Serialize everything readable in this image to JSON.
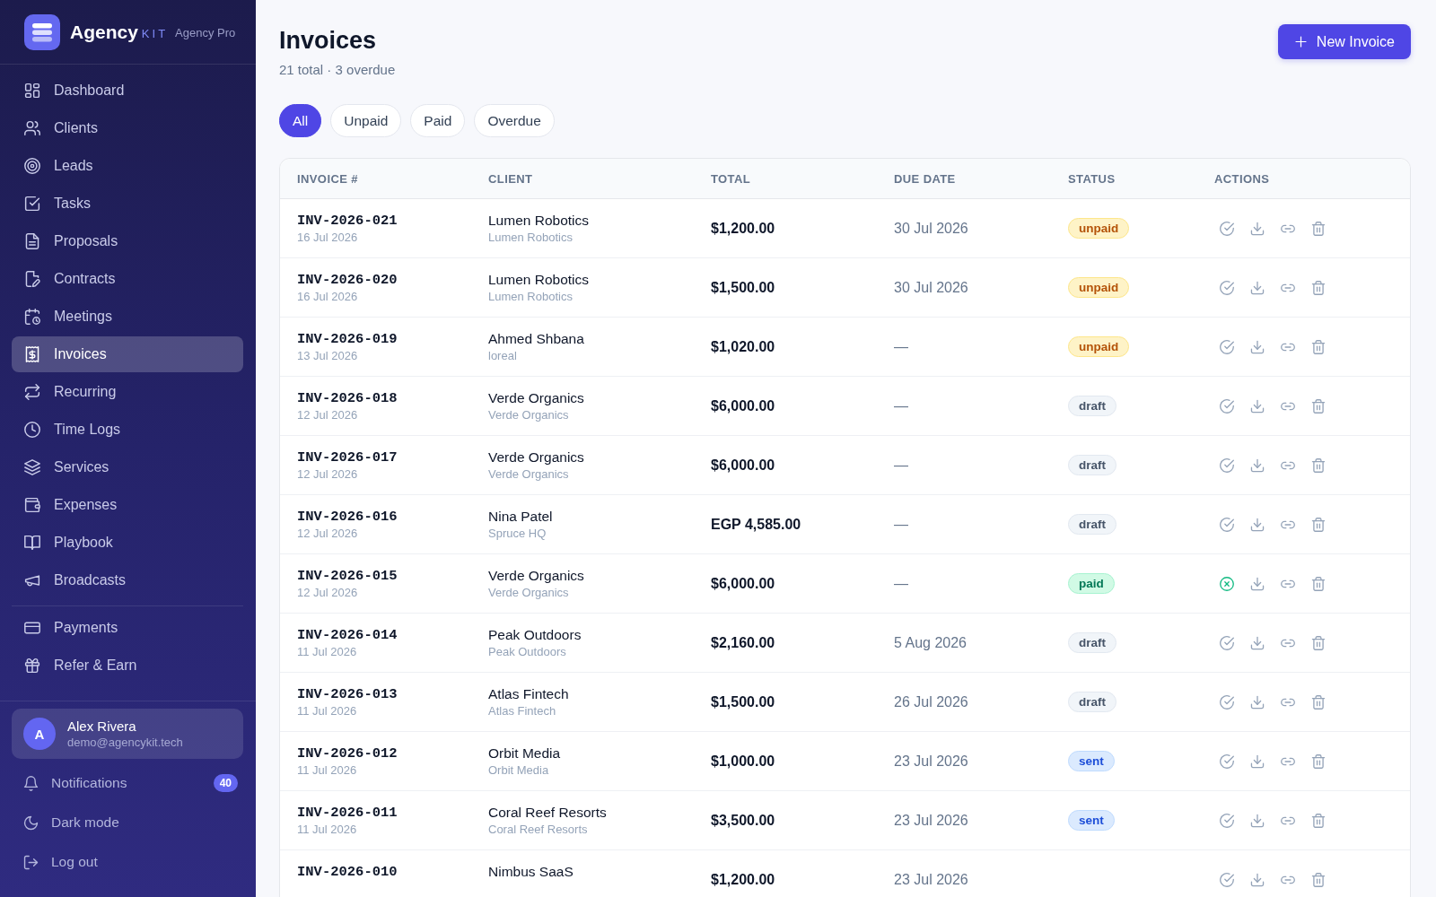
{
  "sidebar": {
    "brand": {
      "name": "Agency",
      "suffix": "KIT",
      "plan": "Agency Pro"
    },
    "sections": [
      {
        "items": [
          {
            "label": "Dashboard",
            "selected": false
          },
          {
            "label": "Clients",
            "selected": false
          },
          {
            "label": "Leads",
            "selected": false
          },
          {
            "label": "Tasks",
            "selected": false
          },
          {
            "label": "Proposals",
            "selected": false
          },
          {
            "label": "Contracts",
            "selected": false
          },
          {
            "label": "Meetings",
            "selected": false
          },
          {
            "label": "Invoices",
            "selected": true
          },
          {
            "label": "Recurring",
            "selected": false
          },
          {
            "label": "Time Logs",
            "selected": false
          },
          {
            "label": "Services",
            "selected": false
          },
          {
            "label": "Expenses",
            "selected": false
          },
          {
            "label": "Playbook",
            "selected": false
          },
          {
            "label": "Broadcasts",
            "selected": false
          }
        ]
      },
      {
        "items": [
          {
            "label": "Payments",
            "selected": false
          },
          {
            "label": "Refer & Earn",
            "selected": false
          }
        ]
      }
    ],
    "user": {
      "initial": "A",
      "name": "Alex Rivera",
      "email": "demo@agencykit.tech"
    },
    "footer_items": [
      {
        "label": "Notifications",
        "badge": "40"
      },
      {
        "label": "Dark mode"
      },
      {
        "label": "Log out"
      }
    ]
  },
  "header": {
    "title": "Invoices",
    "subtitle": "21 total · 3 overdue",
    "primary_button": {
      "label": "New Invoice"
    }
  },
  "filters": [
    {
      "label": "All",
      "selected": true
    },
    {
      "label": "Unpaid",
      "selected": false
    },
    {
      "label": "Paid",
      "selected": false
    },
    {
      "label": "Overdue",
      "selected": false
    }
  ],
  "table": {
    "columns": [
      "INVOICE #",
      "CLIENT",
      "TOTAL",
      "DUE DATE",
      "STATUS",
      "ACTIONS"
    ],
    "rows": [
      {
        "invoice": "INV-2026-021",
        "date": "16 Jul 2026",
        "client": "Lumen Robotics",
        "company": "Lumen Robotics",
        "total": "$1,200.00",
        "due_date": "30 Jul 2026",
        "status": {
          "label": "unpaid",
          "kind": "unpaid"
        }
      },
      {
        "invoice": "INV-2026-020",
        "date": "16 Jul 2026",
        "client": "Lumen Robotics",
        "company": "Lumen Robotics",
        "total": "$1,500.00",
        "due_date": "30 Jul 2026",
        "status": {
          "label": "unpaid",
          "kind": "unpaid"
        }
      },
      {
        "invoice": "INV-2026-019",
        "date": "13 Jul 2026",
        "client": "Ahmed Shbana",
        "company": "loreal",
        "total": "$1,020.00",
        "due_date": "—",
        "status": {
          "label": "unpaid",
          "kind": "unpaid"
        }
      },
      {
        "invoice": "INV-2026-018",
        "date": "12 Jul 2026",
        "client": "Verde Organics",
        "company": "Verde Organics",
        "total": "$6,000.00",
        "due_date": "—",
        "status": {
          "label": "draft",
          "kind": "draft"
        }
      },
      {
        "invoice": "INV-2026-017",
        "date": "12 Jul 2026",
        "client": "Verde Organics",
        "company": "Verde Organics",
        "total": "$6,000.00",
        "due_date": "—",
        "status": {
          "label": "draft",
          "kind": "draft"
        }
      },
      {
        "invoice": "INV-2026-016",
        "date": "12 Jul 2026",
        "client": "Nina Patel",
        "company": "Spruce HQ",
        "total": "EGP 4,585.00",
        "due_date": "—",
        "status": {
          "label": "draft",
          "kind": "draft"
        }
      },
      {
        "invoice": "INV-2026-015",
        "date": "12 Jul 2026",
        "client": "Verde Organics",
        "company": "Verde Organics",
        "total": "$6,000.00",
        "due_date": "—",
        "status": {
          "label": "paid",
          "kind": "paid"
        }
      },
      {
        "invoice": "INV-2026-014",
        "date": "11 Jul 2026",
        "client": "Peak Outdoors",
        "company": "Peak Outdoors",
        "total": "$2,160.00",
        "due_date": "5 Aug 2026",
        "status": {
          "label": "draft",
          "kind": "draft"
        }
      },
      {
        "invoice": "INV-2026-013",
        "date": "11 Jul 2026",
        "client": "Atlas Fintech",
        "company": "Atlas Fintech",
        "total": "$1,500.00",
        "due_date": "26 Jul 2026",
        "status": {
          "label": "draft",
          "kind": "draft"
        }
      },
      {
        "invoice": "INV-2026-012",
        "date": "11 Jul 2026",
        "client": "Orbit Media",
        "company": "Orbit Media",
        "total": "$1,000.00",
        "due_date": "23 Jul 2026",
        "status": {
          "label": "sent",
          "kind": "sent"
        }
      },
      {
        "invoice": "INV-2026-011",
        "date": "11 Jul 2026",
        "client": "Coral Reef Resorts",
        "company": "Coral Reef Resorts",
        "total": "$3,500.00",
        "due_date": "23 Jul 2026",
        "status": {
          "label": "sent",
          "kind": "sent"
        }
      },
      {
        "invoice": "INV-2026-010",
        "client": "Nimbus SaaS",
        "total": "$1,200.00",
        "due_date": "23 Jul 2026"
      }
    ]
  }
}
